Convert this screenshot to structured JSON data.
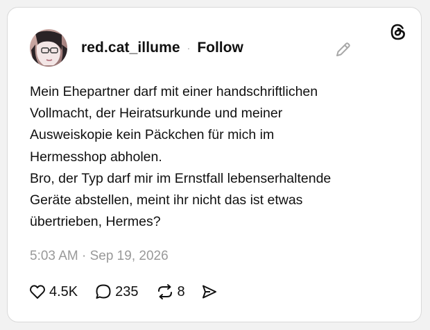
{
  "post": {
    "author": {
      "username": "red.cat_illume",
      "avatar_icon": "profile-photo"
    },
    "separator": "·",
    "follow_label": "Follow",
    "text": "Mein Ehepartner darf mit einer handschriftlichen\nVollmacht, der Heiratsurkunde und meiner\nAusweiskopie kein Päckchen für mich im\nHermesshop abholen.\nBro, der Typ darf mir im Ernstfall lebenserhaltende\nGeräte abstellen, meint ihr nicht das ist etwas\nübertrieben, Hermes?",
    "timestamp": "5:03 AM · Sep 19, 2026",
    "stats": {
      "likes": "4.5K",
      "replies": "235",
      "reposts": "8"
    }
  },
  "icons": {
    "edit": "pencil-icon",
    "brand": "threads-logo",
    "like": "heart-icon",
    "reply": "speech-bubble-icon",
    "repost": "repost-icon",
    "share": "send-icon"
  },
  "colors": {
    "text": "#101010",
    "muted": "#999999",
    "card_border": "#d9d9d9",
    "background": "#f2f2f2"
  }
}
